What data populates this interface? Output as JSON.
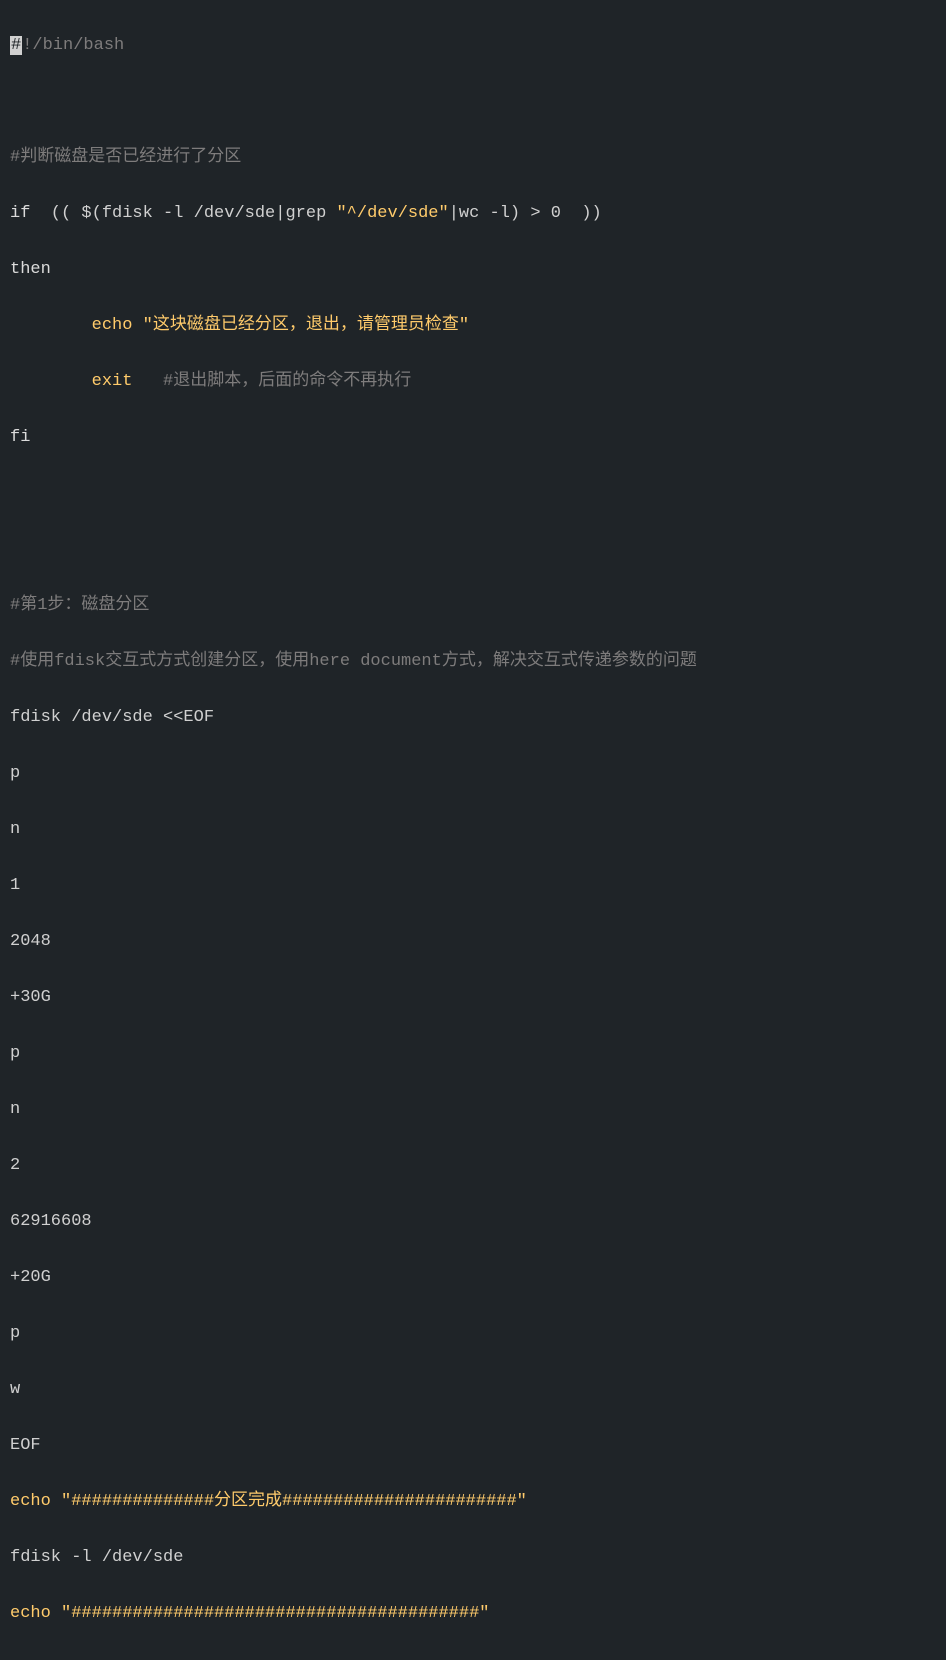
{
  "code": {
    "shebang_hash": "#",
    "shebang_rest": "!/bin/bash",
    "blank": "",
    "comment_check": "#判断磁盘是否已经进行了分区",
    "if_kw": "if",
    "if_cond_pre": "  (( $(",
    "fdisk_cmd": "fdisk",
    "if_cond_mid": " -l /dev/sde|",
    "grep_cmd": "grep",
    "if_cond_str": " \"^/dev/sde\"",
    "if_cond_pipe": "|",
    "wc_cmd": "wc",
    "if_cond_end": " -l) > 0  ))",
    "then_kw": "then",
    "echo_indent": "        ",
    "echo_kw": "echo",
    "echo_str": " \"这块磁盘已经分区，退出，请管理员检查\"",
    "exit_indent": "        ",
    "exit_kw": "exit",
    "exit_comment": "   #退出脚本，后面的命令不再执行",
    "fi_kw": "fi",
    "comment_step1": "#第1步：磁盘分区",
    "comment_heredoc": "#使用fdisk交互式方式创建分区，使用here document方式，解决交互式传递参数的问题",
    "fdisk_heredoc": "fdisk /dev/sde <<EOF",
    "hd_p1": "p",
    "hd_n1": "n",
    "hd_1": "1",
    "hd_2048": "2048",
    "hd_30g": "+30G",
    "hd_p2": "p",
    "hd_n2": "n",
    "hd_2": "2",
    "hd_62916608": "62916608",
    "hd_20g": "+20G",
    "hd_p3": "p",
    "hd_w": "w",
    "hd_eof": "EOF",
    "echo2_kw": "echo",
    "echo2_str": " \"##############分区完成#######################\"",
    "fdisk_list": "fdisk -l /dev/sde",
    "echo3_kw": "echo",
    "echo3_str": " \"########################################\""
  }
}
